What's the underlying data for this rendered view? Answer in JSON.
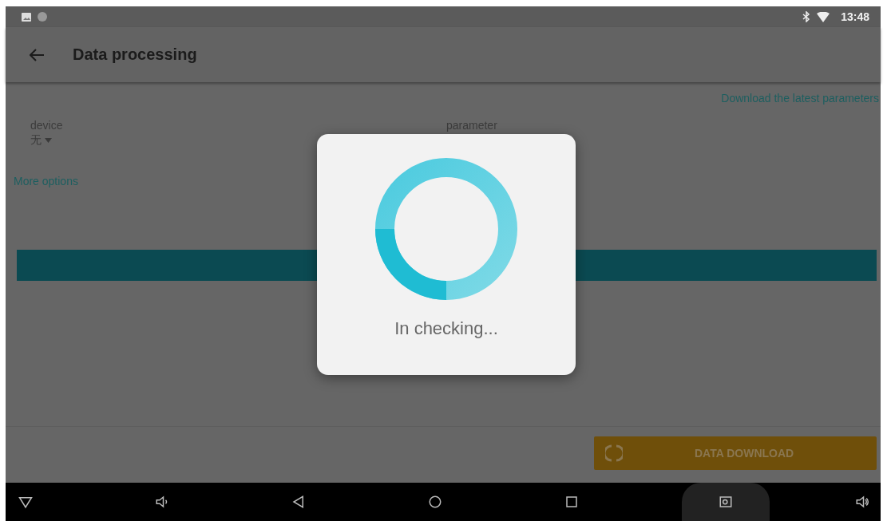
{
  "status_bar": {
    "time": "13:48"
  },
  "app_bar": {
    "title": "Data processing"
  },
  "download_link": "Download the latest parameters",
  "fields": [
    {
      "label": "device",
      "value": "无"
    },
    {
      "label": "parameter"
    }
  ],
  "more_options": "More options",
  "action_button": {
    "label": "DATA DOWNLOAD",
    "disabled": true
  },
  "dialog": {
    "message": "In checking..."
  }
}
